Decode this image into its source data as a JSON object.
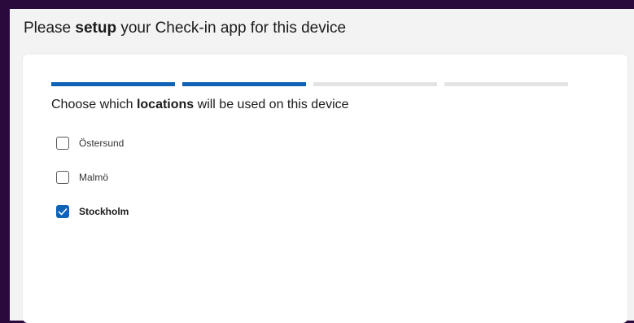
{
  "title": {
    "prefix": "Please ",
    "bold": "setup",
    "suffix": " your Check-in app for this device"
  },
  "progress": {
    "total_steps": 4,
    "completed_steps": 2
  },
  "heading": {
    "prefix": "Choose which ",
    "bold": "locations",
    "suffix": " will be used on this device"
  },
  "locations": [
    {
      "label": "Östersund",
      "checked": false
    },
    {
      "label": "Malmö",
      "checked": false
    },
    {
      "label": "Stockholm",
      "checked": true
    }
  ],
  "colors": {
    "accent": "#0f63b7",
    "background": "#2a0a3d"
  }
}
